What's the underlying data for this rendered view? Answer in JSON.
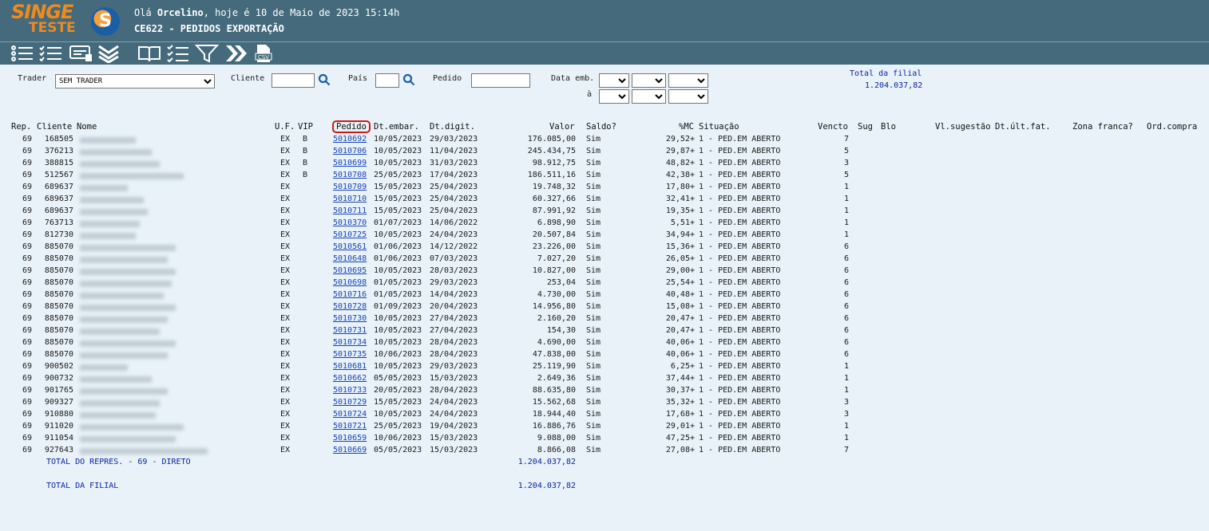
{
  "header": {
    "logo_top": "SINGE",
    "logo_bottom": "TESTE",
    "greeting_prefix": "Olá",
    "user": "Orcelino",
    "greeting_suffix": ", hoje é 10 de Maio de 2023 15:14h",
    "title": "CE622 - PEDIDOS EXPORTAÇÃO"
  },
  "toolbar": [
    "list-icon",
    "checklist-icon",
    "card-icon",
    "double-chevron-down-icon",
    "book-icon",
    "tasks-icon",
    "filter-icon",
    "double-chevron-right-icon",
    "csv-icon"
  ],
  "filters": {
    "trader_label": "Trader",
    "trader_value": "SEM TRADER",
    "cliente_label": "Cliente",
    "pais_label": "País",
    "pedido_label": "Pedido",
    "data_emb_label": "Data emb.",
    "ate_label": "à"
  },
  "total_filial_top": {
    "label": "Total da filial",
    "value": "1.204.037,82"
  },
  "columns": {
    "rep": "Rep.",
    "cliente": "Cliente",
    "nome": "Nome",
    "uf": "U.F.",
    "vip": "VIP",
    "pedido": "Pedido",
    "dtemb": "Dt.embar.",
    "dtdig": "Dt.digit.",
    "valor": "Valor",
    "saldo": "Saldo?",
    "mc": "%MC",
    "situacao": "Situação",
    "vencto": "Vencto",
    "sug": "Sug",
    "blo": "Blo",
    "vlsug": "Vl.sugestão",
    "dtult": "Dt.últ.fat.",
    "zona": "Zona franca?",
    "ordc": "Ord.compra"
  },
  "rows": [
    {
      "rep": "69",
      "cliente": "168505",
      "uf": "EX",
      "vip": "B",
      "pedido": "5010692",
      "dtemb": "10/05/2023",
      "dtdig": "29/03/2023",
      "valor": "176.085,00",
      "saldo": "Sim",
      "mc": "29,52+",
      "sit": "1 - PED.EM ABERTO",
      "vencto": "7"
    },
    {
      "rep": "69",
      "cliente": "376213",
      "uf": "EX",
      "vip": "B",
      "pedido": "5010706",
      "dtemb": "10/05/2023",
      "dtdig": "11/04/2023",
      "valor": "245.434,75",
      "saldo": "Sim",
      "mc": "29,87+",
      "sit": "1 - PED.EM ABERTO",
      "vencto": "5"
    },
    {
      "rep": "69",
      "cliente": "388815",
      "uf": "EX",
      "vip": "B",
      "pedido": "5010699",
      "dtemb": "10/05/2023",
      "dtdig": "31/03/2023",
      "valor": "98.912,75",
      "saldo": "Sim",
      "mc": "48,82+",
      "sit": "1 - PED.EM ABERTO",
      "vencto": "3"
    },
    {
      "rep": "69",
      "cliente": "512567",
      "uf": "EX",
      "vip": "B",
      "pedido": "5010708",
      "dtemb": "25/05/2023",
      "dtdig": "17/04/2023",
      "valor": "186.511,16",
      "saldo": "Sim",
      "mc": "42,38+",
      "sit": "1 - PED.EM ABERTO",
      "vencto": "5"
    },
    {
      "rep": "69",
      "cliente": "689637",
      "uf": "EX",
      "vip": "",
      "pedido": "5010709",
      "dtemb": "15/05/2023",
      "dtdig": "25/04/2023",
      "valor": "19.748,32",
      "saldo": "Sim",
      "mc": "17,80+",
      "sit": "1 - PED.EM ABERTO",
      "vencto": "1"
    },
    {
      "rep": "69",
      "cliente": "689637",
      "uf": "EX",
      "vip": "",
      "pedido": "5010710",
      "dtemb": "15/05/2023",
      "dtdig": "25/04/2023",
      "valor": "60.327,66",
      "saldo": "Sim",
      "mc": "32,41+",
      "sit": "1 - PED.EM ABERTO",
      "vencto": "1"
    },
    {
      "rep": "69",
      "cliente": "689637",
      "uf": "EX",
      "vip": "",
      "pedido": "5010711",
      "dtemb": "15/05/2023",
      "dtdig": "25/04/2023",
      "valor": "87.991,92",
      "saldo": "Sim",
      "mc": "19,35+",
      "sit": "1 - PED.EM ABERTO",
      "vencto": "1"
    },
    {
      "rep": "69",
      "cliente": "763713",
      "uf": "EX",
      "vip": "",
      "pedido": "5010370",
      "dtemb": "01/07/2023",
      "dtdig": "14/06/2022",
      "valor": "6.898,90",
      "saldo": "Sim",
      "mc": "5,51+",
      "sit": "1 - PED.EM ABERTO",
      "vencto": "1"
    },
    {
      "rep": "69",
      "cliente": "812730",
      "uf": "EX",
      "vip": "",
      "pedido": "5010725",
      "dtemb": "10/05/2023",
      "dtdig": "24/04/2023",
      "valor": "20.507,84",
      "saldo": "Sim",
      "mc": "34,94+",
      "sit": "1 - PED.EM ABERTO",
      "vencto": "1"
    },
    {
      "rep": "69",
      "cliente": "885070",
      "uf": "EX",
      "vip": "",
      "pedido": "5010561",
      "dtemb": "01/06/2023",
      "dtdig": "14/12/2022",
      "valor": "23.226,00",
      "saldo": "Sim",
      "mc": "15,36+",
      "sit": "1 - PED.EM ABERTO",
      "vencto": "6"
    },
    {
      "rep": "69",
      "cliente": "885070",
      "uf": "EX",
      "vip": "",
      "pedido": "5010648",
      "dtemb": "01/06/2023",
      "dtdig": "07/03/2023",
      "valor": "7.027,20",
      "saldo": "Sim",
      "mc": "26,05+",
      "sit": "1 - PED.EM ABERTO",
      "vencto": "6"
    },
    {
      "rep": "69",
      "cliente": "885070",
      "uf": "EX",
      "vip": "",
      "pedido": "5010695",
      "dtemb": "10/05/2023",
      "dtdig": "28/03/2023",
      "valor": "10.827,00",
      "saldo": "Sim",
      "mc": "29,00+",
      "sit": "1 - PED.EM ABERTO",
      "vencto": "6"
    },
    {
      "rep": "69",
      "cliente": "885070",
      "uf": "EX",
      "vip": "",
      "pedido": "5010698",
      "dtemb": "01/05/2023",
      "dtdig": "29/03/2023",
      "valor": "253,04",
      "saldo": "Sim",
      "mc": "25,54+",
      "sit": "1 - PED.EM ABERTO",
      "vencto": "6"
    },
    {
      "rep": "69",
      "cliente": "885070",
      "uf": "EX",
      "vip": "",
      "pedido": "5010716",
      "dtemb": "01/05/2023",
      "dtdig": "14/04/2023",
      "valor": "4.730,00",
      "saldo": "Sim",
      "mc": "40,48+",
      "sit": "1 - PED.EM ABERTO",
      "vencto": "6"
    },
    {
      "rep": "69",
      "cliente": "885070",
      "uf": "EX",
      "vip": "",
      "pedido": "5010728",
      "dtemb": "01/09/2023",
      "dtdig": "20/04/2023",
      "valor": "14.956,80",
      "saldo": "Sim",
      "mc": "15,08+",
      "sit": "1 - PED.EM ABERTO",
      "vencto": "6"
    },
    {
      "rep": "69",
      "cliente": "885070",
      "uf": "EX",
      "vip": "",
      "pedido": "5010730",
      "dtemb": "10/05/2023",
      "dtdig": "27/04/2023",
      "valor": "2.160,20",
      "saldo": "Sim",
      "mc": "20,47+",
      "sit": "1 - PED.EM ABERTO",
      "vencto": "6"
    },
    {
      "rep": "69",
      "cliente": "885070",
      "uf": "EX",
      "vip": "",
      "pedido": "5010731",
      "dtemb": "10/05/2023",
      "dtdig": "27/04/2023",
      "valor": "154,30",
      "saldo": "Sim",
      "mc": "20,47+",
      "sit": "1 - PED.EM ABERTO",
      "vencto": "6"
    },
    {
      "rep": "69",
      "cliente": "885070",
      "uf": "EX",
      "vip": "",
      "pedido": "5010734",
      "dtemb": "10/05/2023",
      "dtdig": "28/04/2023",
      "valor": "4.690,00",
      "saldo": "Sim",
      "mc": "40,06+",
      "sit": "1 - PED.EM ABERTO",
      "vencto": "6"
    },
    {
      "rep": "69",
      "cliente": "885070",
      "uf": "EX",
      "vip": "",
      "pedido": "5010735",
      "dtemb": "10/06/2023",
      "dtdig": "28/04/2023",
      "valor": "47.838,00",
      "saldo": "Sim",
      "mc": "40,06+",
      "sit": "1 - PED.EM ABERTO",
      "vencto": "6"
    },
    {
      "rep": "69",
      "cliente": "900502",
      "uf": "EX",
      "vip": "",
      "pedido": "5010681",
      "dtemb": "10/05/2023",
      "dtdig": "29/03/2023",
      "valor": "25.119,90",
      "saldo": "Sim",
      "mc": "6,25+",
      "sit": "1 - PED.EM ABERTO",
      "vencto": "1"
    },
    {
      "rep": "69",
      "cliente": "900732",
      "uf": "EX",
      "vip": "",
      "pedido": "5010662",
      "dtemb": "05/05/2023",
      "dtdig": "15/03/2023",
      "valor": "2.649,36",
      "saldo": "Sim",
      "mc": "37,44+",
      "sit": "1 - PED.EM ABERTO",
      "vencto": "1"
    },
    {
      "rep": "69",
      "cliente": "901765",
      "uf": "EX",
      "vip": "",
      "pedido": "5010733",
      "dtemb": "20/05/2023",
      "dtdig": "28/04/2023",
      "valor": "88.635,80",
      "saldo": "Sim",
      "mc": "30,37+",
      "sit": "1 - PED.EM ABERTO",
      "vencto": "1"
    },
    {
      "rep": "69",
      "cliente": "909327",
      "uf": "EX",
      "vip": "",
      "pedido": "5010729",
      "dtemb": "15/05/2023",
      "dtdig": "24/04/2023",
      "valor": "15.562,68",
      "saldo": "Sim",
      "mc": "35,32+",
      "sit": "1 - PED.EM ABERTO",
      "vencto": "3"
    },
    {
      "rep": "69",
      "cliente": "910880",
      "uf": "EX",
      "vip": "",
      "pedido": "5010724",
      "dtemb": "10/05/2023",
      "dtdig": "24/04/2023",
      "valor": "18.944,40",
      "saldo": "Sim",
      "mc": "17,68+",
      "sit": "1 - PED.EM ABERTO",
      "vencto": "3"
    },
    {
      "rep": "69",
      "cliente": "911020",
      "uf": "EX",
      "vip": "",
      "pedido": "5010721",
      "dtemb": "25/05/2023",
      "dtdig": "19/04/2023",
      "valor": "16.886,76",
      "saldo": "Sim",
      "mc": "29,01+",
      "sit": "1 - PED.EM ABERTO",
      "vencto": "1"
    },
    {
      "rep": "69",
      "cliente": "911054",
      "uf": "EX",
      "vip": "",
      "pedido": "5010659",
      "dtemb": "10/06/2023",
      "dtdig": "15/03/2023",
      "valor": "9.088,00",
      "saldo": "Sim",
      "mc": "47,25+",
      "sit": "1 - PED.EM ABERTO",
      "vencto": "1"
    },
    {
      "rep": "69",
      "cliente": "927643",
      "uf": "EX",
      "vip": "",
      "pedido": "5010669",
      "dtemb": "05/05/2023",
      "dtdig": "15/03/2023",
      "valor": "8.866,08",
      "saldo": "Sim",
      "mc": "27,08+",
      "sit": "1 - PED.EM ABERTO",
      "vencto": "7"
    }
  ],
  "totals": {
    "repres_label": "TOTAL DO REPRES. - 69 - DIRETO",
    "repres_value": "1.204.037,82",
    "filial_label": "TOTAL DA FILIAL",
    "filial_value": "1.204.037,82"
  }
}
